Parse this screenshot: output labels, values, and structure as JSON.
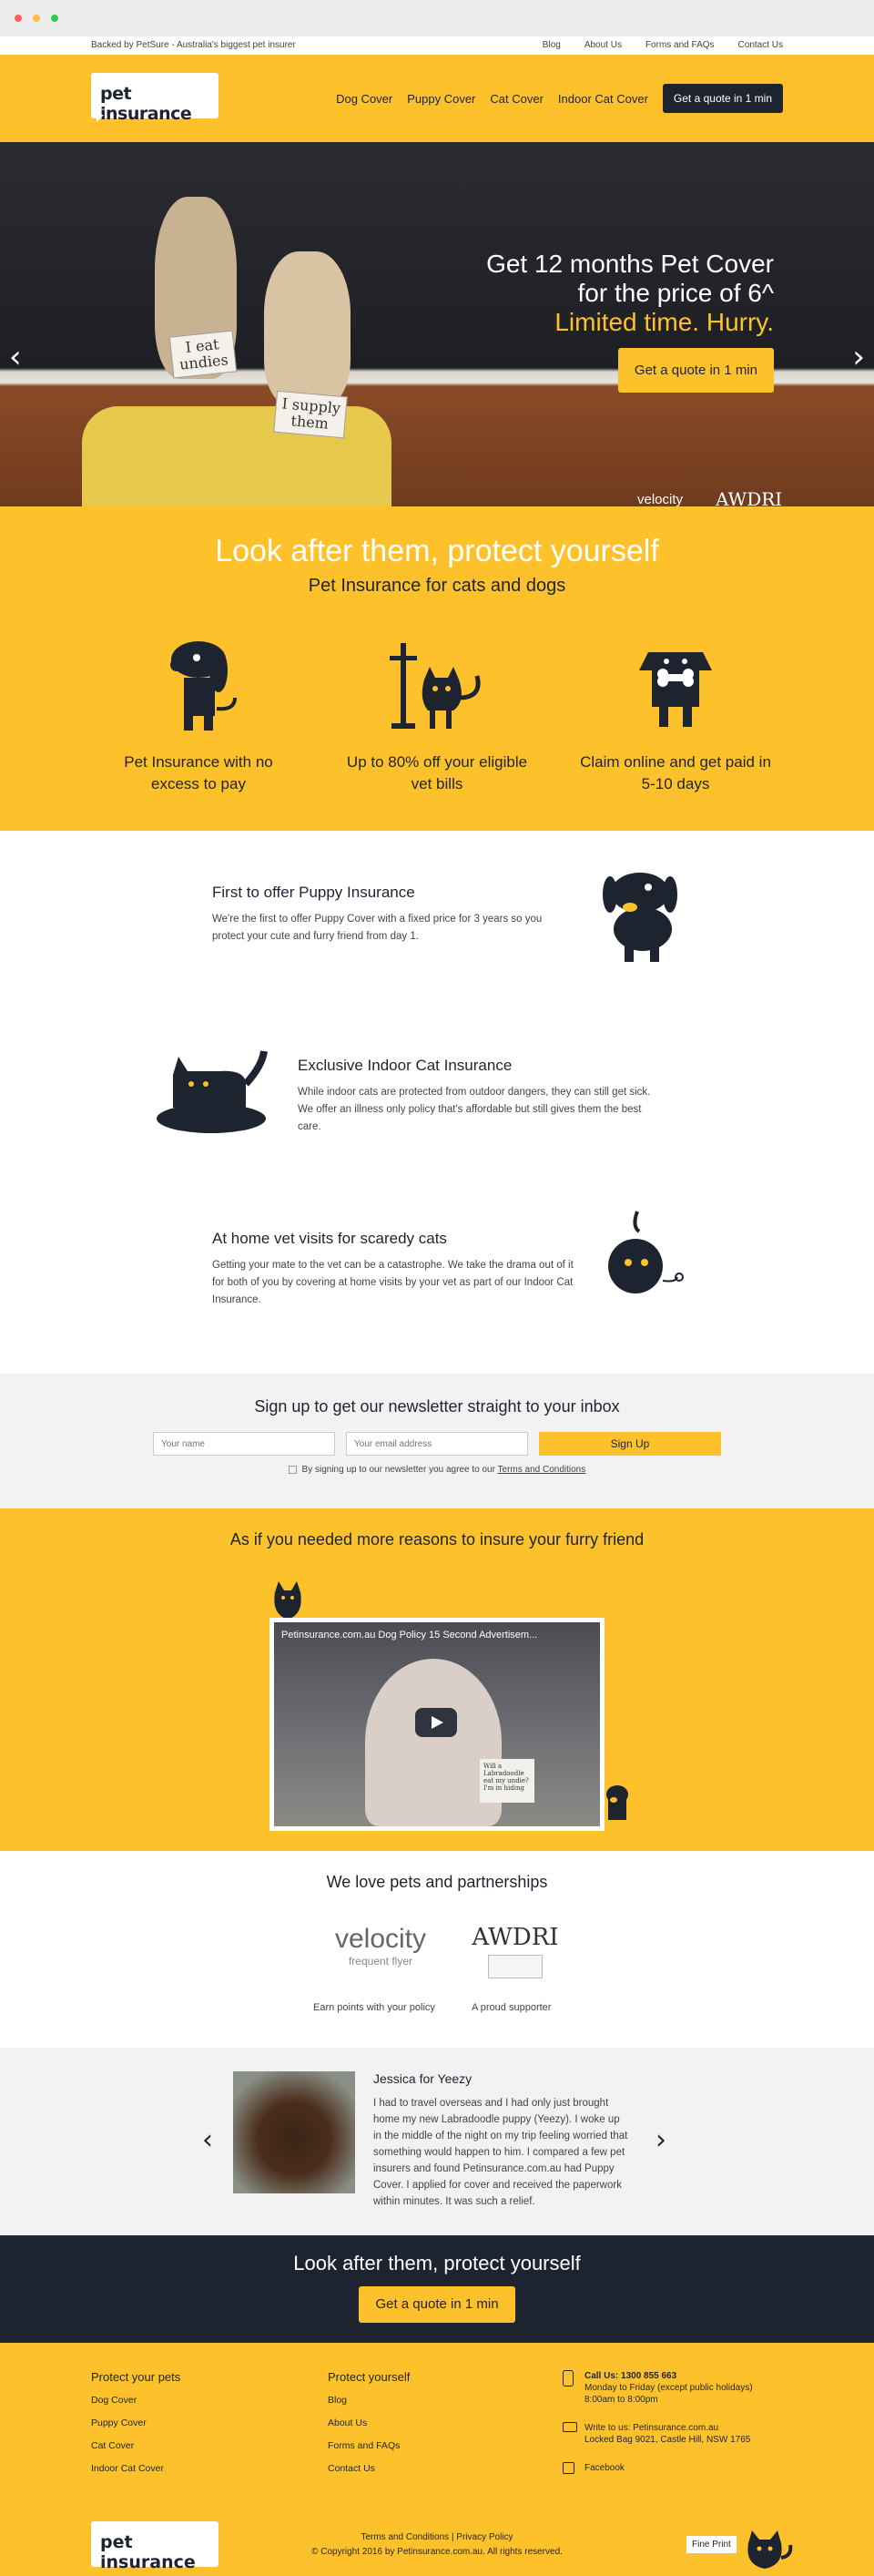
{
  "topbar": {
    "backed_by": "Backed by PetSure - Australia's biggest pet insurer",
    "links": [
      "Blog",
      "About Us",
      "Forms and FAQs",
      "Contact Us"
    ]
  },
  "header": {
    "logo_text": "pet insurance",
    "nav": [
      "Dog Cover",
      "Puppy Cover",
      "Cat Cover",
      "Indoor Cat Cover"
    ],
    "cta": "Get a quote in 1 min"
  },
  "hero": {
    "sign_left": "I eat undies",
    "sign_right": "I supply them",
    "line1": "Get 12 months Pet Cover",
    "line2": "for the price of 6^",
    "line3": "Limited time. Hurry.",
    "cta": "Get a quote in 1 min",
    "prev_icon": "‹",
    "next_icon": "›",
    "partner1": "velocity",
    "partner2": "AWDRI"
  },
  "features": {
    "title": "Look after them, protect yourself",
    "subtitle": "Pet Insurance for cats and dogs",
    "items": [
      {
        "icon": "dog-icon",
        "text": "Pet Insurance with no excess to pay"
      },
      {
        "icon": "vet-cat-icon",
        "text": "Up to 80% off your eligible vet bills"
      },
      {
        "icon": "dog-bone-icon",
        "text": "Claim online and get paid in 5-10 days"
      }
    ]
  },
  "benefits": [
    {
      "title": "First to offer Puppy Insurance",
      "text": "We're the first to offer Puppy Cover with a fixed price for 3 years so you protect your cute and furry friend from day 1."
    },
    {
      "title": "Exclusive Indoor Cat Insurance",
      "text": "While indoor cats are protected from outdoor dangers, they can still get sick. We offer an illness only policy that's affordable but still gives them the best care."
    },
    {
      "title": "At home vet visits for scaredy cats",
      "text": "Getting your mate to the vet can be a catastrophe. We take the drama out of it for both of you by covering at home visits by your vet as part of our Indoor Cat Insurance."
    }
  ],
  "newsletter": {
    "title": "Sign up to get our newsletter straight to your inbox",
    "name_placeholder": "Your name",
    "email_placeholder": "Your email address",
    "button": "Sign Up",
    "terms_prefix": "By signing up to our newsletter you agree to our",
    "terms_link": "Terms and Conditions"
  },
  "video": {
    "title": "As if you needed more reasons to insure your furry friend",
    "video_title": "Petinsurance.com.au Dog Policy 15 Second Advertisem...",
    "sign_text": "Will a Labradoodle eat my undie? I'm in hiding"
  },
  "partners": {
    "title": "We love pets and partnerships",
    "items": [
      {
        "name": "velocity",
        "sub": "frequent flyer",
        "caption": "Earn points with your policy"
      },
      {
        "name": "AWDRI",
        "sub": "",
        "caption": "A proud supporter"
      }
    ]
  },
  "testimonial": {
    "name": "Jessica for Yeezy",
    "text": "I had to travel overseas and I had only just brought home my new Labradoodle puppy (Yeezy). I woke up in the middle of the night on my trip feeling worried that something would happen to him. I compared a few pet insurers and found Petinsurance.com.au had Puppy Cover. I applied for cover and received the paperwork within minutes. It was such a relief.",
    "prev_icon": "‹",
    "next_icon": "›"
  },
  "cta_band": {
    "title": "Look after them, protect yourself",
    "button": "Get a quote in 1 min"
  },
  "footer": {
    "col1_title": "Protect your pets",
    "col1_links": [
      "Dog Cover",
      "Puppy Cover",
      "Cat Cover",
      "Indoor Cat Cover"
    ],
    "col2_title": "Protect yourself",
    "col2_links": [
      "Blog",
      "About Us",
      "Forms and FAQs",
      "Contact Us"
    ],
    "phone_label": "Call Us: 1300 855 663",
    "phone_hours": "Monday to Friday (except public holidays)",
    "phone_time": "8:00am to 8:00pm",
    "write_label": "Write to us: Petinsurance.com.au",
    "write_address": "Locked Bag 9021, Castle Hill, NSW 1765",
    "facebook": "Facebook",
    "logo_text": "pet insurance",
    "legal1": "Terms and Conditions | Privacy Policy",
    "legal2": "© Copyright 2016 by Petinsurance.com.au. All rights reserved.",
    "print": "Fine Print"
  },
  "colors": {
    "brand_yellow": "#fdc22b",
    "navy": "#1d2430"
  }
}
